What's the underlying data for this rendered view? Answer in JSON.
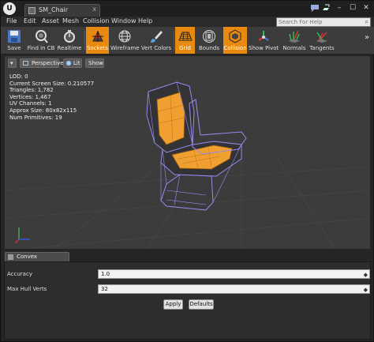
{
  "window": {
    "tab_title": "SM_Chair",
    "tab_close": "x",
    "minimize": "–",
    "maximize": "☐",
    "close": "✕",
    "logo": "U"
  },
  "menu": {
    "items": [
      "File",
      "Edit",
      "Asset",
      "Mesh",
      "Collision",
      "Window",
      "Help"
    ],
    "search_placeholder": "Search For Help"
  },
  "toolbar": {
    "buttons": [
      {
        "label": "Save",
        "icon": "floppy-icon",
        "active": false
      },
      {
        "label": "Find in CB",
        "icon": "magnifier-icon",
        "active": false
      },
      {
        "label": "Realtime",
        "icon": "stopwatch-icon",
        "active": false
      },
      {
        "label": "Sockets",
        "icon": "sockets-icon",
        "active": true
      },
      {
        "label": "Wireframe",
        "icon": "wireframe-icon",
        "active": false
      },
      {
        "label": "Vert Colors",
        "icon": "brush-icon",
        "active": false
      },
      {
        "label": "Grid",
        "icon": "grid-icon",
        "active": true
      },
      {
        "label": "Bounds",
        "icon": "bounds-icon",
        "active": false
      },
      {
        "label": "Collision",
        "icon": "collision-icon",
        "active": true
      },
      {
        "label": "Show Pivot",
        "icon": "pivot-icon",
        "active": false
      },
      {
        "label": "Normals",
        "icon": "normals-icon",
        "active": false
      },
      {
        "label": "Tangents",
        "icon": "tangents-icon",
        "active": false
      }
    ],
    "overflow": "»"
  },
  "viewport": {
    "menu_button": "▾",
    "perspective": "Perspective",
    "lit": "Lit",
    "show": "Show",
    "stats": [
      "LOD:  0",
      "Current Screen Size:  0.210577",
      "Triangles:  1,782",
      "Vertices:  1,467",
      "UV Channels:  1",
      "Approx Size: 80x82x115",
      "Num Primitives:  19"
    ]
  },
  "panel": {
    "tab_label": "Convex Decomposi",
    "rows": [
      {
        "label": "Accuracy",
        "value": "1.0"
      },
      {
        "label": "Max Hull Verts",
        "value": "32"
      }
    ],
    "apply": "Apply",
    "defaults": "Defaults"
  },
  "colors": {
    "accent": "#e98a10",
    "background": "#252525",
    "viewport": "#3c3c3c",
    "collision_wire": "#9a8cf0",
    "mesh_orange": "#f0a030"
  }
}
